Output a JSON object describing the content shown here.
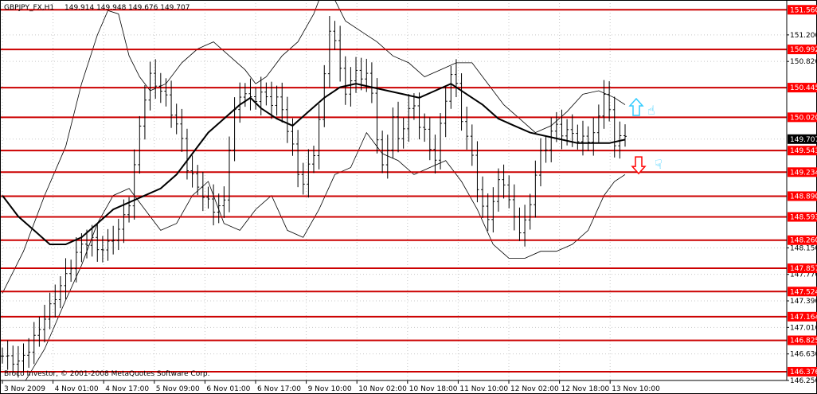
{
  "header": {
    "symbol": "GBPJPY_FX,H1",
    "ohlc": "149.914 149.948 149.676 149.707"
  },
  "footer": {
    "copyright": "Broco Investor, © 2001-2008 MetaQuotes Software Corp."
  },
  "colors": {
    "background": "#ffffff",
    "grid": "#c8c8c8",
    "level_line": "#cc0000",
    "level_label_bg": "#ff0000",
    "candles": "#000000",
    "moving_average": "#000000",
    "bollinger": "#000000",
    "current_price_bg": "#000000",
    "arrow_up": "#33ccff",
    "arrow_down": "#ff0000",
    "hand_icon": "#33ccff"
  },
  "icons": [
    "arrow-up-icon",
    "arrow-down-icon",
    "thumbs-up-hand-icon",
    "thumbs-down-hand-icon"
  ],
  "chart_data": {
    "type": "candlestick",
    "title": "",
    "xlabel": "",
    "ylabel": "",
    "ylim": [
      146.25,
      151.7
    ],
    "grid": true,
    "y_ticks": [
      "151.200",
      "150.820",
      "150.445",
      "150.020",
      "149.707",
      "149.543",
      "149.234",
      "148.890",
      "148.593",
      "148.260",
      "148.150",
      "147.857",
      "147.770",
      "147.524",
      "147.390",
      "147.164",
      "147.010",
      "146.825",
      "146.630",
      "146.376",
      "146.250"
    ],
    "x_ticks": [
      "3 Nov 2009",
      "4 Nov 01:00",
      "4 Nov 17:00",
      "5 Nov 09:00",
      "6 Nov 01:00",
      "6 Nov 17:00",
      "9 Nov 10:00",
      "10 Nov 02:00",
      "10 Nov 18:00",
      "11 Nov 10:00",
      "12 Nov 02:00",
      "12 Nov 18:00",
      "13 Nov 10:00"
    ],
    "current_price": 149.707,
    "levels": [
      {
        "value": 151.56,
        "label": "151.560"
      },
      {
        "value": 150.992,
        "label": "150.992"
      },
      {
        "value": 150.445,
        "label": "150.445"
      },
      {
        "value": 150.02,
        "label": "150.020"
      },
      {
        "value": 149.543,
        "label": "149.543"
      },
      {
        "value": 149.234,
        "label": "149.234"
      },
      {
        "value": 148.89,
        "label": "148.890"
      },
      {
        "value": 148.593,
        "label": "148.593"
      },
      {
        "value": 148.26,
        "label": "148.260"
      },
      {
        "value": 147.857,
        "label": "147.857"
      },
      {
        "value": 147.524,
        "label": "147.524"
      },
      {
        "value": 147.164,
        "label": "147.164"
      },
      {
        "value": 146.825,
        "label": "146.825"
      },
      {
        "value": 146.376,
        "label": "146.376"
      }
    ],
    "price_path": [
      [
        0,
        146.6
      ],
      [
        3,
        146.5
      ],
      [
        5,
        146.7
      ],
      [
        7,
        147.0
      ],
      [
        9,
        147.3
      ],
      [
        11,
        147.6
      ],
      [
        13,
        147.9
      ],
      [
        15,
        148.2
      ],
      [
        17,
        148.25
      ],
      [
        18.5,
        148.1
      ],
      [
        20,
        148.2
      ],
      [
        22,
        148.4
      ],
      [
        24,
        148.8
      ],
      [
        25,
        149.3
      ],
      [
        26,
        149.9
      ],
      [
        27,
        150.3
      ],
      [
        28,
        150.6
      ],
      [
        29,
        150.5
      ],
      [
        31,
        150.3
      ],
      [
        32.5,
        150.0
      ],
      [
        34,
        149.7
      ],
      [
        35,
        149.3
      ],
      [
        36.5,
        149.1
      ],
      [
        38,
        148.9
      ],
      [
        40,
        148.7
      ],
      [
        42,
        148.8
      ],
      [
        43,
        149.6
      ],
      [
        44,
        150.1
      ],
      [
        45,
        150.3
      ],
      [
        46,
        150.4
      ],
      [
        47.5,
        150.2
      ],
      [
        49,
        150.4
      ],
      [
        50.5,
        150.2
      ],
      [
        52,
        150.3
      ],
      [
        53.5,
        150.0
      ],
      [
        55,
        149.6
      ],
      [
        56,
        149.2
      ],
      [
        57,
        149.1
      ],
      [
        58,
        149.3
      ],
      [
        59,
        149.5
      ],
      [
        60,
        150.0
      ],
      [
        61,
        150.6
      ],
      [
        62,
        151.3
      ],
      [
        63,
        151.1
      ],
      [
        64,
        150.7
      ],
      [
        65,
        150.4
      ],
      [
        66,
        150.5
      ],
      [
        67,
        150.7
      ],
      [
        68,
        150.6
      ],
      [
        69,
        150.6
      ],
      [
        70,
        150.4
      ],
      [
        71,
        149.7
      ],
      [
        72,
        149.3
      ],
      [
        73,
        149.6
      ],
      [
        74,
        150.0
      ],
      [
        75,
        149.7
      ],
      [
        76,
        149.9
      ],
      [
        77,
        150.1
      ],
      [
        78,
        150.2
      ],
      [
        79,
        149.9
      ],
      [
        80,
        149.8
      ],
      [
        81,
        149.6
      ],
      [
        82,
        149.4
      ],
      [
        83,
        149.9
      ],
      [
        84,
        150.3
      ],
      [
        85,
        150.6
      ],
      [
        86,
        150.5
      ],
      [
        87,
        150.0
      ],
      [
        88,
        149.7
      ],
      [
        89,
        149.5
      ],
      [
        90,
        149.0
      ],
      [
        91,
        148.7
      ],
      [
        92,
        148.6
      ],
      [
        93,
        148.8
      ],
      [
        94,
        149.1
      ],
      [
        95,
        149.1
      ],
      [
        96,
        148.8
      ],
      [
        97,
        148.6
      ],
      [
        98,
        148.4
      ],
      [
        99,
        148.5
      ],
      [
        100,
        148.8
      ],
      [
        101,
        149.2
      ],
      [
        102,
        149.5
      ],
      [
        103,
        149.6
      ],
      [
        104,
        149.8
      ],
      [
        105,
        149.9
      ],
      [
        106,
        149.8
      ],
      [
        107,
        149.8
      ],
      [
        108,
        149.8
      ],
      [
        109,
        149.7
      ],
      [
        110,
        149.7
      ],
      [
        111,
        149.7
      ],
      [
        112,
        149.8
      ],
      [
        113,
        150.0
      ],
      [
        114,
        150.4
      ],
      [
        115,
        150.1
      ],
      [
        116,
        149.6
      ],
      [
        117,
        149.8
      ],
      [
        118,
        149.7
      ]
    ],
    "ma_path": [
      [
        0,
        148.9
      ],
      [
        3,
        148.6
      ],
      [
        6,
        148.4
      ],
      [
        9,
        148.2
      ],
      [
        12,
        148.2
      ],
      [
        15,
        148.3
      ],
      [
        18,
        148.5
      ],
      [
        21,
        148.7
      ],
      [
        24,
        148.8
      ],
      [
        27,
        148.9
      ],
      [
        30,
        149.0
      ],
      [
        33,
        149.2
      ],
      [
        36,
        149.5
      ],
      [
        39,
        149.8
      ],
      [
        42,
        150.0
      ],
      [
        45,
        150.2
      ],
      [
        47,
        150.3
      ],
      [
        49,
        150.15
      ],
      [
        52,
        150.0
      ],
      [
        55,
        149.9
      ],
      [
        58,
        150.1
      ],
      [
        61,
        150.3
      ],
      [
        64,
        150.45
      ],
      [
        67,
        150.5
      ],
      [
        70,
        150.45
      ],
      [
        73,
        150.4
      ],
      [
        76,
        150.35
      ],
      [
        79,
        150.3
      ],
      [
        82,
        150.4
      ],
      [
        85,
        150.5
      ],
      [
        88,
        150.35
      ],
      [
        91,
        150.2
      ],
      [
        94,
        150.0
      ],
      [
        97,
        149.9
      ],
      [
        100,
        149.8
      ],
      [
        103,
        149.75
      ],
      [
        106,
        149.7
      ],
      [
        109,
        149.65
      ],
      [
        112,
        149.65
      ],
      [
        115,
        149.65
      ],
      [
        118,
        149.7
      ]
    ],
    "bb_upper_path": [
      [
        0,
        147.5
      ],
      [
        4,
        148.1
      ],
      [
        8,
        148.9
      ],
      [
        12,
        149.6
      ],
      [
        15,
        150.5
      ],
      [
        18,
        151.2
      ],
      [
        20,
        151.55
      ],
      [
        22,
        151.5
      ],
      [
        24,
        150.9
      ],
      [
        26,
        150.6
      ],
      [
        28,
        150.4
      ],
      [
        31,
        150.5
      ],
      [
        34,
        150.8
      ],
      [
        37,
        151.0
      ],
      [
        40,
        151.1
      ],
      [
        43,
        150.9
      ],
      [
        46,
        150.7
      ],
      [
        48,
        150.5
      ],
      [
        50,
        150.6
      ],
      [
        53,
        150.9
      ],
      [
        56,
        151.1
      ],
      [
        59,
        151.5
      ],
      [
        61,
        151.9
      ],
      [
        63,
        151.7
      ],
      [
        65,
        151.4
      ],
      [
        67,
        151.3
      ],
      [
        69,
        151.2
      ],
      [
        71,
        151.1
      ],
      [
        74,
        150.9
      ],
      [
        77,
        150.8
      ],
      [
        80,
        150.6
      ],
      [
        83,
        150.7
      ],
      [
        86,
        150.8
      ],
      [
        89,
        150.8
      ],
      [
        92,
        150.5
      ],
      [
        95,
        150.2
      ],
      [
        98,
        150.0
      ],
      [
        101,
        149.8
      ],
      [
        104,
        149.9
      ],
      [
        107,
        150.1
      ],
      [
        110,
        150.35
      ],
      [
        113,
        150.4
      ],
      [
        116,
        150.3
      ],
      [
        118,
        150.2
      ]
    ],
    "bb_lower_path": [
      [
        0,
        146.0
      ],
      [
        4,
        146.2
      ],
      [
        8,
        146.7
      ],
      [
        12,
        147.4
      ],
      [
        15,
        147.9
      ],
      [
        18,
        148.5
      ],
      [
        21,
        148.9
      ],
      [
        24,
        149.0
      ],
      [
        27,
        148.7
      ],
      [
        30,
        148.4
      ],
      [
        33,
        148.5
      ],
      [
        36,
        148.9
      ],
      [
        39,
        149.1
      ],
      [
        42,
        148.5
      ],
      [
        45,
        148.4
      ],
      [
        48,
        148.7
      ],
      [
        51,
        148.9
      ],
      [
        54,
        148.4
      ],
      [
        57,
        148.3
      ],
      [
        60,
        148.7
      ],
      [
        63,
        149.2
      ],
      [
        66,
        149.3
      ],
      [
        69,
        149.8
      ],
      [
        72,
        149.5
      ],
      [
        75,
        149.4
      ],
      [
        78,
        149.2
      ],
      [
        81,
        149.3
      ],
      [
        84,
        149.4
      ],
      [
        87,
        149.1
      ],
      [
        90,
        148.7
      ],
      [
        93,
        148.2
      ],
      [
        96,
        148.0
      ],
      [
        99,
        148.0
      ],
      [
        102,
        148.1
      ],
      [
        105,
        148.1
      ],
      [
        108,
        148.2
      ],
      [
        111,
        148.4
      ],
      [
        114,
        148.9
      ],
      [
        116,
        149.1
      ],
      [
        118,
        149.2
      ]
    ]
  }
}
